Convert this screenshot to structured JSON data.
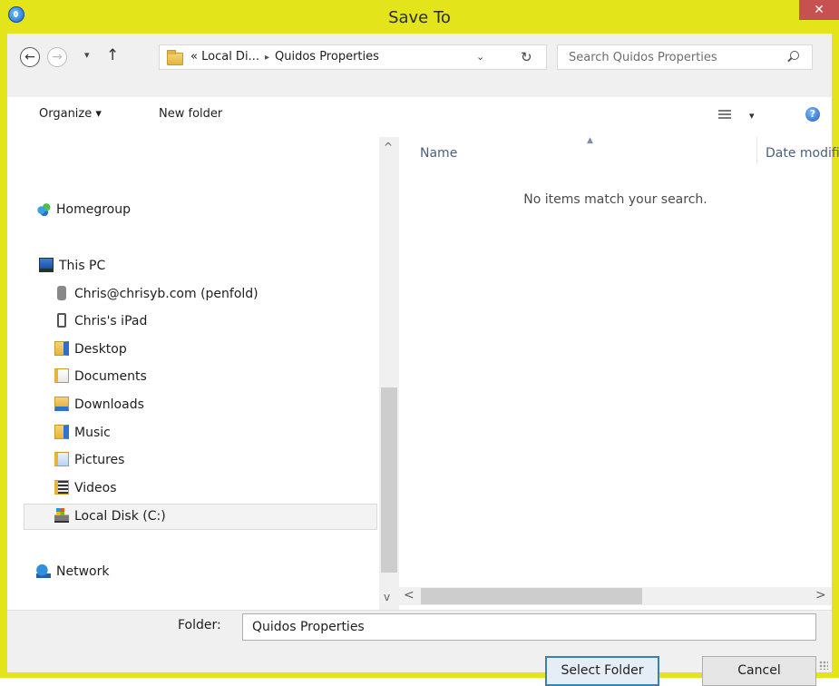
{
  "window": {
    "title": "Save To",
    "close_glyph": "✕",
    "accent": "#e4e41a",
    "close_color": "#c75050"
  },
  "nav": {
    "back_glyph": "←",
    "forward_glyph": "→",
    "recent_glyph": "▾",
    "up_glyph": "↑",
    "address": {
      "prefix": "«",
      "crumbs": [
        "Local Di...",
        "Quidos Properties"
      ],
      "separator": "▸",
      "dropdown_glyph": "⌄",
      "refresh_glyph": "↻"
    },
    "search_placeholder": "Search Quidos Properties"
  },
  "toolbar": {
    "organize_label": "Organize ▾",
    "new_folder_label": "New folder",
    "views_dropdown_glyph": "▾",
    "help_glyph": "?"
  },
  "tree": {
    "homegroup": "Homegroup",
    "this_pc": "This PC",
    "items": [
      {
        "label": "Chris@chrisyb.com (penfold)",
        "icon": "phone-icon"
      },
      {
        "label": "Chris's iPad",
        "icon": "ipad-icon"
      },
      {
        "label": "Desktop",
        "icon": "desktop-folder-icon"
      },
      {
        "label": "Documents",
        "icon": "documents-folder-icon"
      },
      {
        "label": "Downloads",
        "icon": "downloads-folder-icon"
      },
      {
        "label": "Music",
        "icon": "music-folder-icon"
      },
      {
        "label": "Pictures",
        "icon": "pictures-folder-icon"
      },
      {
        "label": "Videos",
        "icon": "videos-folder-icon"
      },
      {
        "label": "Local Disk (C:)",
        "icon": "local-disk-icon",
        "selected": true
      }
    ],
    "network": "Network",
    "scroll_up_glyph": "^",
    "scroll_down_glyph": "v"
  },
  "content": {
    "columns": [
      "Name",
      "Date modified"
    ],
    "sort_glyph": "▲",
    "empty_message": "No items match your search.",
    "scroll_left_glyph": "<",
    "scroll_right_glyph": ">"
  },
  "footer": {
    "folder_label": "Folder:",
    "folder_value": "Quidos Properties",
    "select_button": "Select Folder",
    "cancel_button": "Cancel"
  }
}
